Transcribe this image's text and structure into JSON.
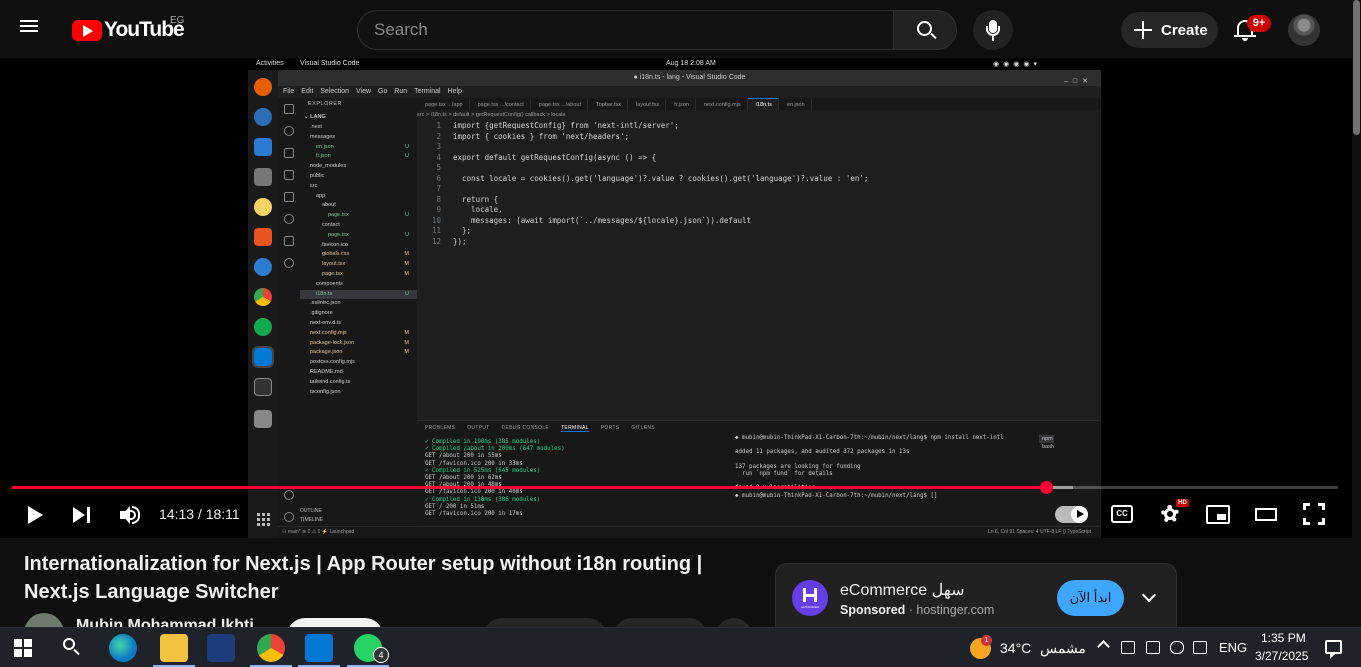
{
  "masthead": {
    "logo_text": "YouTube",
    "country_code": "EG",
    "search_placeholder": "Search",
    "create_label": "Create",
    "notification_count": "9+"
  },
  "video_frame": {
    "top_bar": {
      "activities": "Activities",
      "app_name": "Visual Studio Code",
      "clock": "Aug 18  2:08 AM"
    },
    "window_title": "● i18n.ts - lang - Visual Studio Code",
    "menu": [
      "File",
      "Edit",
      "Selection",
      "View",
      "Go",
      "Run",
      "Terminal",
      "Help"
    ],
    "explorer": {
      "header": "EXPLORER",
      "project": "LANG",
      "items": [
        {
          "label": ".next",
          "depth": 1,
          "badge": ""
        },
        {
          "label": "messages",
          "depth": 1,
          "badge": ""
        },
        {
          "label": "en.json",
          "depth": 2,
          "badge": "U"
        },
        {
          "label": "fr.json",
          "depth": 2,
          "badge": "U"
        },
        {
          "label": "node_modules",
          "depth": 1,
          "badge": ""
        },
        {
          "label": "public",
          "depth": 1,
          "badge": ""
        },
        {
          "label": "src",
          "depth": 1,
          "badge": ""
        },
        {
          "label": "app",
          "depth": 2,
          "badge": ""
        },
        {
          "label": "about",
          "depth": 3,
          "badge": ""
        },
        {
          "label": "page.tsx",
          "depth": 4,
          "badge": "U"
        },
        {
          "label": "contact",
          "depth": 3,
          "badge": ""
        },
        {
          "label": "page.tsx",
          "depth": 4,
          "badge": "U"
        },
        {
          "label": "favicon.ico",
          "depth": 3,
          "badge": ""
        },
        {
          "label": "globals.css",
          "depth": 3,
          "badge": "M"
        },
        {
          "label": "layout.tsx",
          "depth": 3,
          "badge": "M"
        },
        {
          "label": "page.tsx",
          "depth": 3,
          "badge": "M"
        },
        {
          "label": "compoents",
          "depth": 2,
          "badge": ""
        },
        {
          "label": "i18n.ts",
          "depth": 2,
          "badge": "U"
        },
        {
          "label": ".eslintrc.json",
          "depth": 1,
          "badge": ""
        },
        {
          "label": ".gitignore",
          "depth": 1,
          "badge": ""
        },
        {
          "label": "next-env.d.ts",
          "depth": 1,
          "badge": ""
        },
        {
          "label": "next.config.mjs",
          "depth": 1,
          "badge": "M"
        },
        {
          "label": "package-lock.json",
          "depth": 1,
          "badge": "M"
        },
        {
          "label": "package.json",
          "depth": 1,
          "badge": "M"
        },
        {
          "label": "postcss.config.mjs",
          "depth": 1,
          "badge": ""
        },
        {
          "label": "README.md",
          "depth": 1,
          "badge": ""
        },
        {
          "label": "tailwind.config.ts",
          "depth": 1,
          "badge": ""
        },
        {
          "label": "tsconfig.json",
          "depth": 1,
          "badge": ""
        }
      ],
      "outline": "OUTLINE",
      "timeline": "TIMELINE"
    },
    "tabs": [
      "page.tsx .../app",
      "page.tsx .../contact",
      "page.tsx .../about",
      "Topbar.tsx",
      "layout.tsx",
      "fr.json",
      "next.config.mjs",
      "i18n.ts",
      "en.json"
    ],
    "active_tab": "i18n.ts",
    "breadcrumb": "src > i18n.ts > default > getRequestConfig() callback > locale",
    "code": [
      "import {getRequestConfig} from 'next-intl/server';",
      "import { cookies } from 'next/headers';",
      "",
      "export default getRequestConfig(async () => {",
      "",
      "  const locale = cookies().get('language')?.value ? cookies().get('language')?.value : 'en';",
      "",
      "  return {",
      "    locale,",
      "    messages: (await import(`../messages/${locale}.json`)).default",
      "  };",
      "});"
    ],
    "panel_tabs": [
      "PROBLEMS",
      "OUTPUT",
      "DEBUG CONSOLE",
      "TERMINAL",
      "PORTS",
      "GITLENS"
    ],
    "terminal_left": [
      "✓ Compiled in 190ms (385 modules)",
      "✓ Compiled /about in 200ms (647 modules)",
      "GET /about 200 in 55ms",
      "GET /favicon.ico 200 in 33ms",
      "✓ Compiled in 525ms (645 modules)",
      "GET /about 200 in 62ms",
      "GET /about 200 in 48ms",
      "GET /favicon.ico 200 in 40ms",
      "✓ Compiled in 138ms (386 modules)",
      "GET / 200 in 51ms",
      "GET /favicon.ico 200 in 17ms"
    ],
    "terminal_right": [
      "◆ mubin@mubin-ThinkPad-X1-Carbon-7th:~/mubin/next/lang$ npm install next-intl",
      "",
      "added 11 packages, and audited 372 packages in 13s",
      "",
      "137 packages are looking for funding",
      "  run `npm fund` for details",
      "",
      "found 0 vulnerabilities",
      "◆ mubin@mubin-ThinkPad-X1-Carbon-7th:~/mubin/next/lang$ []"
    ],
    "terminal_list": [
      "npm",
      "bash"
    ],
    "status_right": "Ln 6, Col 91   Spaces: 4   UTF-8   LF   {} TypeScript"
  },
  "player": {
    "time": "14:13 / 18:11",
    "progress": 0.78,
    "buffered": 0.8,
    "cc_label": "CC",
    "hd_label": "HD"
  },
  "video": {
    "title": "Internationalization for Next.js | App Router setup without i18n routing | Next.js Language Switcher",
    "channel": "Mubin Mohammad Ikhti..."
  },
  "ad": {
    "title": "eCommerce سهل",
    "sponsored": "Sponsored",
    "domain": "hostinger.com",
    "cta": "ابدأ الآن",
    "logo_text": "HOSTINGER"
  },
  "taskbar": {
    "temperature": "34°C",
    "weather": "مشمس",
    "weather_badge": "1",
    "lang": "ENG",
    "time": "1:35 PM",
    "date": "3/27/2025",
    "whatsapp_count": "4"
  }
}
